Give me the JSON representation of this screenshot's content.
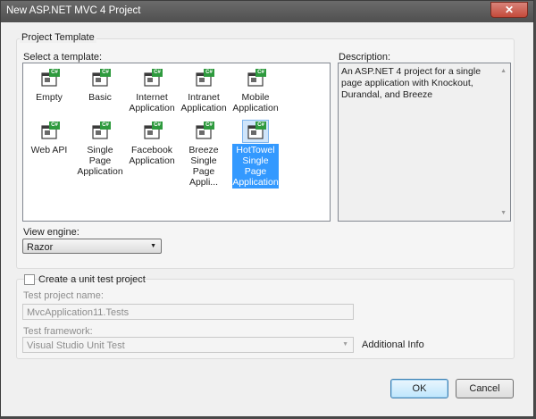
{
  "window": {
    "title": "New ASP.NET MVC 4 Project",
    "close_glyph": "✕"
  },
  "project_template": {
    "group_label": "Project Template",
    "select_label": "Select a template:",
    "templates": [
      {
        "label": "Empty",
        "selected": false
      },
      {
        "label": "Basic",
        "selected": false
      },
      {
        "label": "Internet Application",
        "selected": false
      },
      {
        "label": "Intranet Application",
        "selected": false
      },
      {
        "label": "Mobile Application",
        "selected": false
      },
      {
        "label": "Web API",
        "selected": false
      },
      {
        "label": "Single Page Application",
        "selected": false
      },
      {
        "label": "Facebook Application",
        "selected": false
      },
      {
        "label": "Breeze Single Page Appli...",
        "selected": false
      },
      {
        "label": "HotTowel Single Page Application",
        "selected": true
      }
    ],
    "icon_badge": "C#",
    "description_label": "Description:",
    "description_text": "An ASP.NET 4 project for a single page application with Knockout, Durandal, and Breeze",
    "view_engine_label": "View engine:",
    "view_engine_value": "Razor"
  },
  "unit_test": {
    "checkbox_label": "Create a unit test project",
    "checked": false,
    "test_project_name_label": "Test project name:",
    "test_project_name_value": "MvcApplication11.Tests",
    "test_framework_label": "Test framework:",
    "test_framework_value": "Visual Studio Unit Test",
    "additional_info": "Additional Info"
  },
  "buttons": {
    "ok": "OK",
    "cancel": "Cancel"
  },
  "colors": {
    "selection": "#3399ff",
    "titlebar": "#5a5a5a"
  }
}
